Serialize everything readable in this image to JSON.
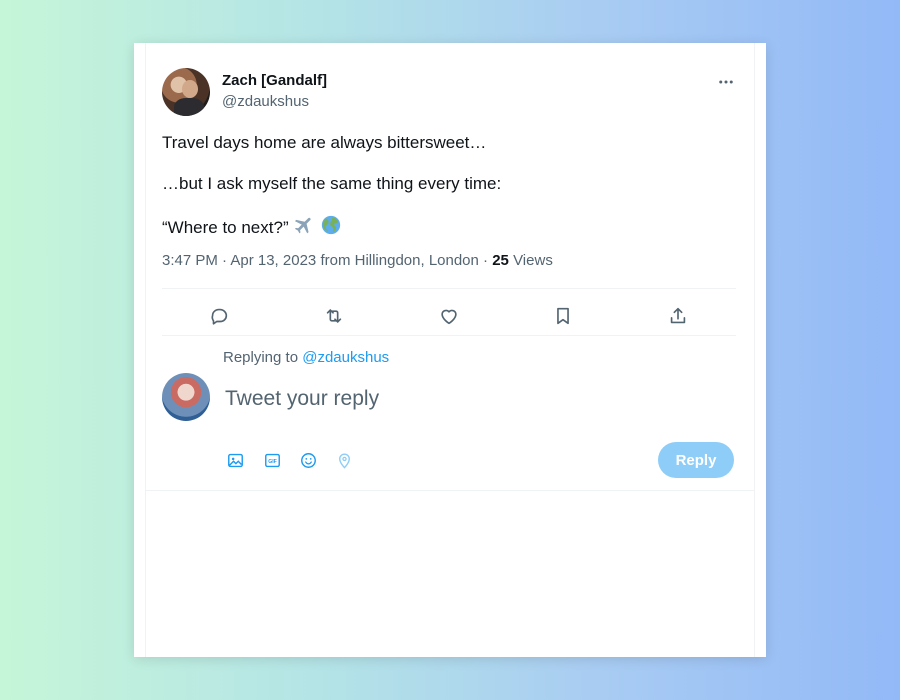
{
  "tweet": {
    "author": {
      "display_name": "Zach [Gandalf]",
      "handle": "@zdaukshus"
    },
    "lines": [
      "Travel days home are always bittersweet…",
      "…but I ask myself the same thing every time:",
      "“Where to next?”"
    ],
    "emojis": [
      "✈️",
      "🌍"
    ],
    "meta": {
      "timestamp": "3:47 PM · Apr 13, 2023",
      "location": "from Hillingdon, London",
      "views_count": "25",
      "views_label": "Views"
    }
  },
  "actions": [
    {
      "icon": "reply-icon"
    },
    {
      "icon": "retweet-icon"
    },
    {
      "icon": "like-icon"
    },
    {
      "icon": "bookmark-icon"
    },
    {
      "icon": "share-icon"
    }
  ],
  "reply_box": {
    "replying_prefix": "Replying to",
    "replying_to": "@zdaukshus",
    "placeholder": "Tweet your reply",
    "tools": [
      "image-icon",
      "gif-icon",
      "emoji-icon",
      "location-icon"
    ],
    "button_label": "Reply"
  },
  "colors": {
    "accent": "#1d9bf0",
    "reply_button": "#8ecdf8",
    "secondary_text": "#536471"
  }
}
